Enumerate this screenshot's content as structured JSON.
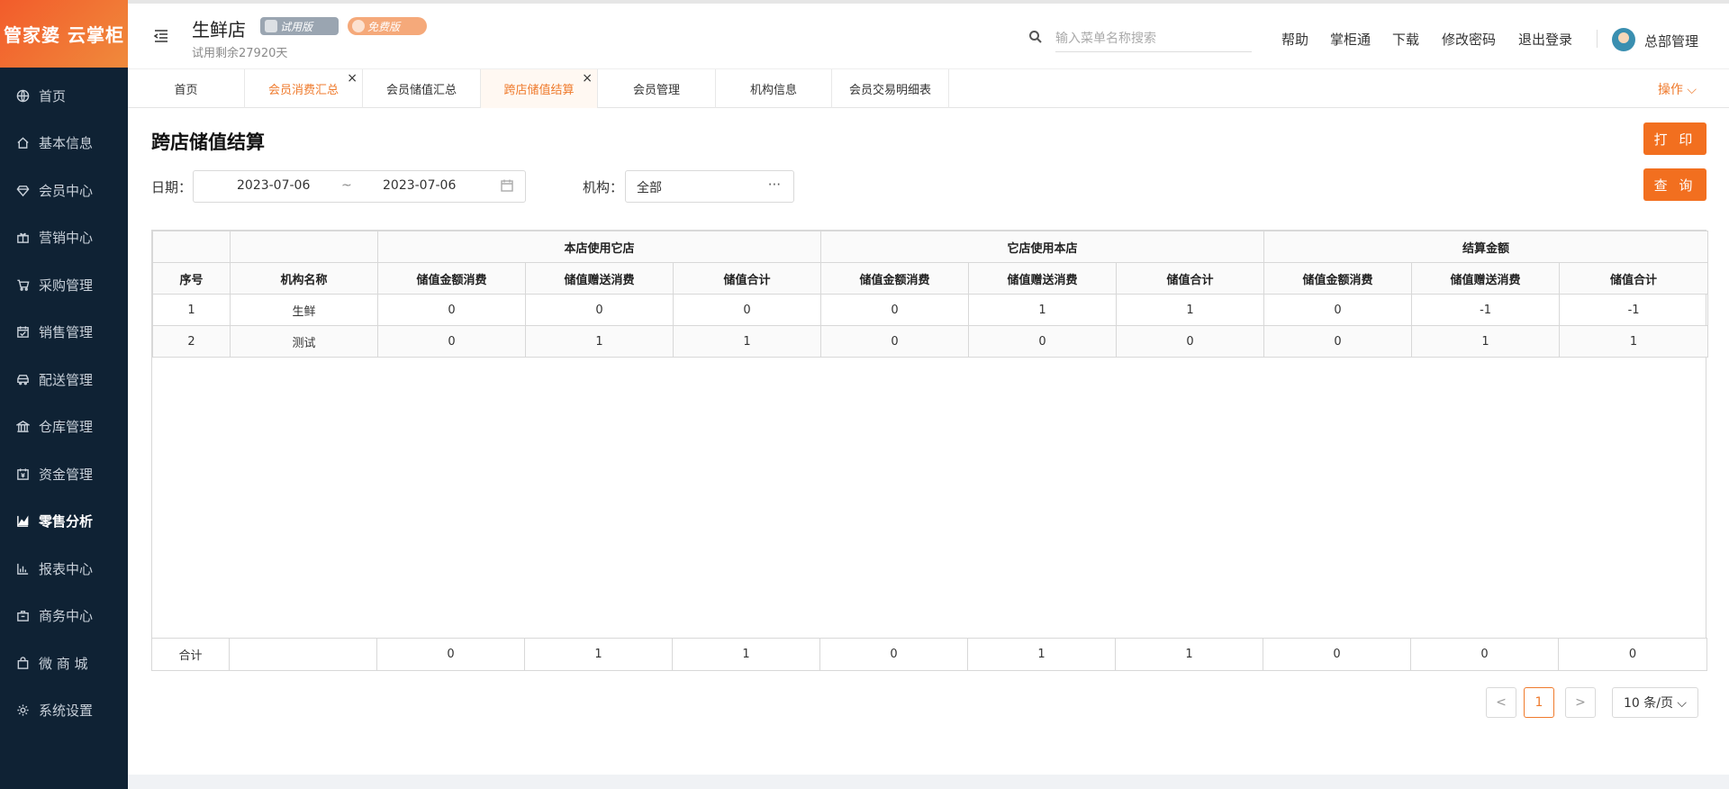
{
  "app": {
    "logo": "管家婆 云掌柜"
  },
  "sidebar": {
    "items": [
      {
        "label": "首页",
        "icon": "globe-icon"
      },
      {
        "label": "基本信息",
        "icon": "home-icon"
      },
      {
        "label": "会员中心",
        "icon": "diamond-icon"
      },
      {
        "label": "营销中心",
        "icon": "gift-icon"
      },
      {
        "label": "采购管理",
        "icon": "cart-icon"
      },
      {
        "label": "销售管理",
        "icon": "calendar-icon"
      },
      {
        "label": "配送管理",
        "icon": "car-icon"
      },
      {
        "label": "仓库管理",
        "icon": "bank-icon"
      },
      {
        "label": "资金管理",
        "icon": "wallet-icon"
      },
      {
        "label": "零售分析",
        "icon": "area-chart-icon"
      },
      {
        "label": "报表中心",
        "icon": "bar-chart-icon"
      },
      {
        "label": "商务中心",
        "icon": "briefcase-icon"
      },
      {
        "label": "微 商 城",
        "icon": "bag-icon"
      },
      {
        "label": "系统设置",
        "icon": "gear-icon"
      }
    ]
  },
  "header": {
    "store_name": "生鲜店",
    "trial_badge": "试用版",
    "pro_badge": "免费版",
    "trial_remaining": "试用剩余27920天",
    "search_placeholder": "输入菜单名称搜索",
    "links": [
      "帮助",
      "掌柜通",
      "下载",
      "修改密码",
      "退出登录"
    ],
    "user": "总部管理"
  },
  "tabs": [
    {
      "label": "首页"
    },
    {
      "label": "会员消费汇总",
      "closable": true
    },
    {
      "label": "会员储值汇总"
    },
    {
      "label": "跨店储值结算",
      "closable": true
    },
    {
      "label": "会员管理"
    },
    {
      "label": "机构信息"
    },
    {
      "label": "会员交易明细表"
    }
  ],
  "tab_close_glyph": "×",
  "tab_ops": "操作 ⌵",
  "page": {
    "title": "跨店储值结算",
    "print_button": "打 印",
    "query_button": "查 询",
    "date_label": "日期：",
    "date_from": "2023-07-06",
    "date_sep": "~",
    "date_to": "2023-07-06",
    "org_label": "机构：",
    "org_value": "全部",
    "org_more": "···"
  },
  "table": {
    "group_headers": [
      "本店使用它店",
      "它店使用本店",
      "结算金额"
    ],
    "col_headers": [
      "序号",
      "机构名称",
      "储值金额消费",
      "储值赠送消费",
      "储值合计",
      "储值金额消费",
      "储值赠送消费",
      "储值合计",
      "储值金额消费",
      "储值赠送消费",
      "储值合计"
    ],
    "rows": [
      [
        "1",
        "生鲜",
        "0",
        "0",
        "0",
        "0",
        "1",
        "1",
        "0",
        "-1",
        "-1"
      ],
      [
        "2",
        "测试",
        "0",
        "1",
        "1",
        "0",
        "0",
        "0",
        "0",
        "1",
        "1"
      ]
    ],
    "footer": [
      "合计",
      "",
      "0",
      "1",
      "1",
      "0",
      "1",
      "1",
      "0",
      "0",
      "0"
    ]
  },
  "pagination": {
    "prev": "<",
    "current": "1",
    "next": ">",
    "page_size": "10 条/页 ⌵"
  }
}
